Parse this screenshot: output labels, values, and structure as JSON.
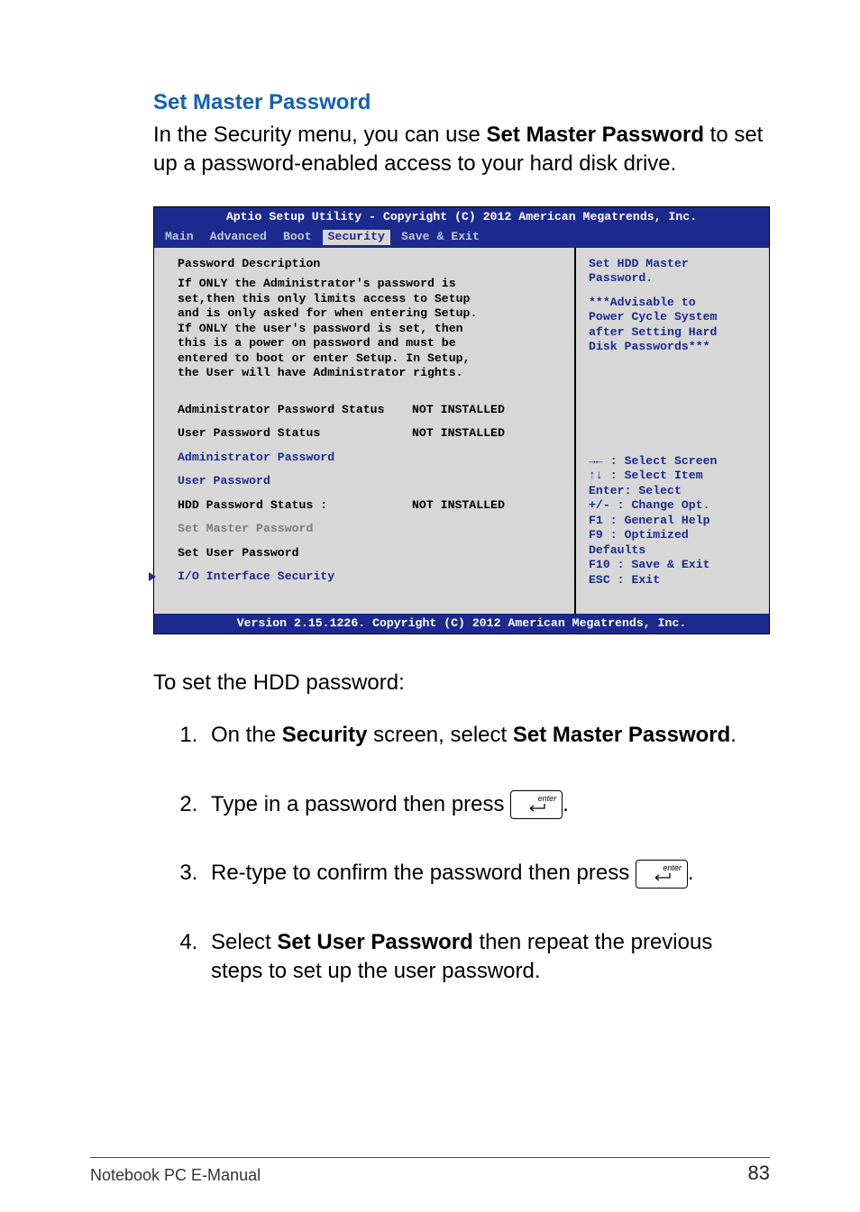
{
  "heading": "Set Master Password",
  "intro_pre": "In the Security menu, you can use ",
  "intro_bold": "Set Master Password",
  "intro_post": " to set up a password-enabled access to your hard disk drive.",
  "bios": {
    "title": "Aptio Setup Utility - Copyright (C) 2012 American Megatrends, Inc.",
    "tabs": [
      "Main",
      "Advanced",
      "Boot",
      "Security",
      "Save & Exit"
    ],
    "active_tab_index": 3,
    "left": {
      "desc_hdr": "Password Description",
      "desc_lines": [
        "If ONLY the Administrator's password is",
        "set,then this only limits access to Setup",
        "and is only asked for when entering Setup.",
        "If ONLY the user's password is set, then",
        "this is a power on password and must be",
        "entered to boot or enter Setup. In Setup,",
        "the User will have Administrator rights."
      ],
      "admin_status_lbl": "Administrator Password Status",
      "admin_status_val": "NOT INSTALLED",
      "user_status_lbl": "User Password Status",
      "user_status_val": "NOT INSTALLED",
      "admin_pw": "Administrator Password",
      "user_pw": "User Password",
      "hdd_status_lbl": "HDD Password Status :",
      "hdd_status_val": "NOT INSTALLED",
      "set_master": "Set Master Password",
      "set_user": "Set User Password",
      "io_sec": "I/O Interface Security"
    },
    "right": {
      "help_lines": [
        "Set HDD Master",
        "Password.",
        "",
        "***Advisable to",
        "Power Cycle System",
        "after Setting Hard",
        "Disk Passwords***"
      ],
      "nav_lines": [
        "→←  : Select Screen",
        "↑↓  : Select Item",
        "Enter: Select",
        "+/-  : Change Opt.",
        "F1   : General Help",
        "F9   : Optimized",
        "Defaults",
        "F10  : Save & Exit",
        "ESC  : Exit"
      ]
    },
    "footer": "Version 2.15.1226. Copyright (C) 2012 American Megatrends, Inc."
  },
  "after_bios": "To set the HDD password:",
  "steps": {
    "s1_pre": "On the ",
    "s1_b1": "Security",
    "s1_mid": " screen, select ",
    "s1_b2": "Set Master Password",
    "s1_post": ".",
    "s2_pre": "Type in a password then press ",
    "s2_post": ".",
    "s3_pre": "Re-type to confirm the password then press ",
    "s3_post": ".",
    "s4_pre": "Select ",
    "s4_b1": "Set User Password",
    "s4_post": " then repeat the previous steps to set up the user password."
  },
  "key_label": "enter",
  "footer_left": "Notebook PC E-Manual",
  "footer_right": "83"
}
